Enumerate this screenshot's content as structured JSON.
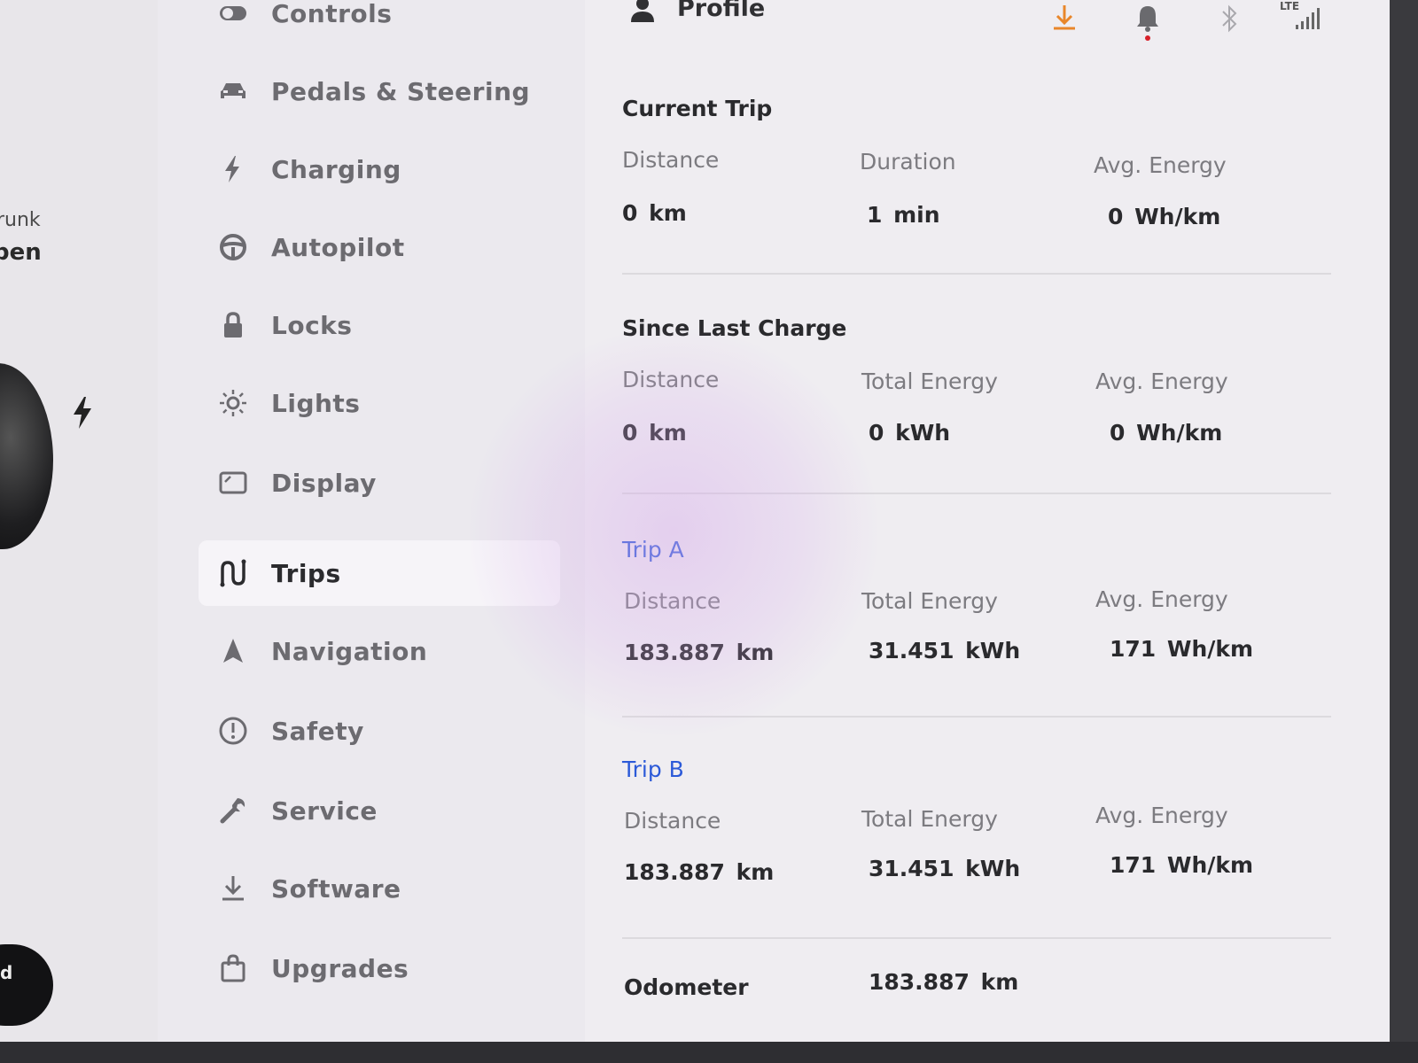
{
  "car_panel": {
    "trunk_label": "runk",
    "trunk_value": "pen",
    "button_label": "d"
  },
  "menu": {
    "items": [
      {
        "label": "Controls",
        "icon": "toggle-icon",
        "active": false
      },
      {
        "label": "Pedals & Steering",
        "icon": "car-icon",
        "active": false
      },
      {
        "label": "Charging",
        "icon": "bolt-icon",
        "active": false
      },
      {
        "label": "Autopilot",
        "icon": "steering-wheel-icon",
        "active": false
      },
      {
        "label": "Locks",
        "icon": "lock-icon",
        "active": false
      },
      {
        "label": "Lights",
        "icon": "sun-icon",
        "active": false
      },
      {
        "label": "Display",
        "icon": "display-icon",
        "active": false
      },
      {
        "label": "Trips",
        "icon": "trips-icon",
        "active": true
      },
      {
        "label": "Navigation",
        "icon": "navigation-arrow-icon",
        "active": false
      },
      {
        "label": "Safety",
        "icon": "alert-circle-icon",
        "active": false
      },
      {
        "label": "Service",
        "icon": "wrench-icon",
        "active": false
      },
      {
        "label": "Software",
        "icon": "download-icon",
        "active": false
      },
      {
        "label": "Upgrades",
        "icon": "shopping-bag-icon",
        "active": false
      }
    ]
  },
  "topbar": {
    "profile_label": "Profile",
    "lte_label": "LTE",
    "accent_download": "#e8862a",
    "notification_dot": "#d8202a"
  },
  "trips": {
    "current_trip": {
      "title": "Current Trip",
      "labels": [
        "Distance",
        "Duration",
        "Avg. Energy"
      ],
      "values": [
        "0 km",
        "1 min",
        "0 Wh/km"
      ]
    },
    "since_last_charge": {
      "title": "Since Last Charge",
      "labels": [
        "Distance",
        "Total Energy",
        "Avg. Energy"
      ],
      "values": [
        "0 km",
        "0 kWh",
        "0 Wh/km"
      ]
    },
    "trip_a": {
      "title": "Trip A",
      "labels": [
        "Distance",
        "Total Energy",
        "Avg. Energy"
      ],
      "values": [
        "183.887 km",
        "31.451 kWh",
        "171 Wh/km"
      ]
    },
    "trip_b": {
      "title": "Trip B",
      "labels": [
        "Distance",
        "Total Energy",
        "Avg. Energy"
      ],
      "values": [
        "183.887 km",
        "31.451 kWh",
        "171 Wh/km"
      ]
    },
    "odometer": {
      "label": "Odometer",
      "value": "183.887 km"
    }
  },
  "colors": {
    "trip_title_blue": "#2c5ad8"
  }
}
